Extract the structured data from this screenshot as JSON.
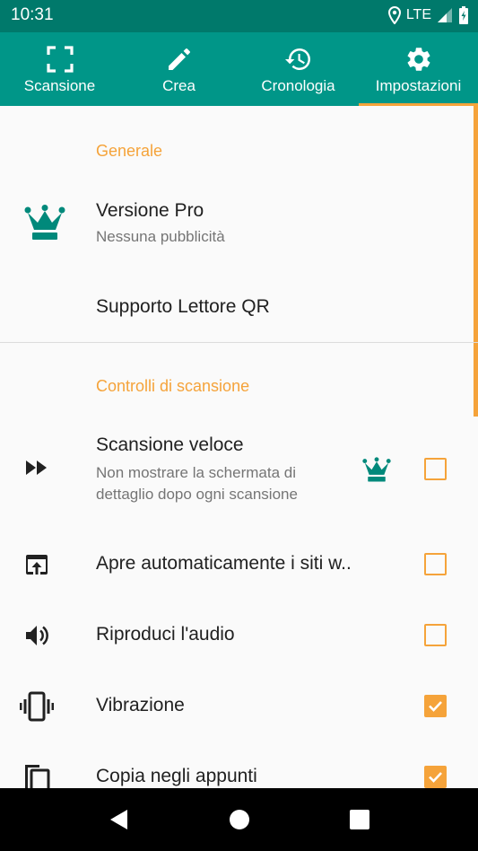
{
  "status_bar": {
    "time": "10:31",
    "network": "LTE",
    "icons": [
      "location-icon",
      "signal-icon",
      "battery-icon"
    ]
  },
  "tabs": [
    {
      "label": "Scansione",
      "icon": "scan-icon",
      "selected": false
    },
    {
      "label": "Crea",
      "icon": "pencil-icon",
      "selected": false
    },
    {
      "label": "Cronologia",
      "icon": "history-icon",
      "selected": false
    },
    {
      "label": "Impostazioni",
      "icon": "gear-icon",
      "selected": true
    }
  ],
  "sections": {
    "general": {
      "title": "Generale",
      "pro": {
        "title": "Versione Pro",
        "summary": "Nessuna pubblicità",
        "icon": "crown-icon"
      },
      "support": {
        "title": "Supporto Lettore QR"
      }
    },
    "scan": {
      "title": "Controlli di scansione",
      "fast_scan": {
        "title": "Scansione veloce",
        "summary": "Non mostrare la schermata di dettaglio dopo ogni scansione",
        "icon": "fast-forward-icon",
        "badge": "crown-icon",
        "checked": false
      },
      "open_sites": {
        "title": "Apre automaticamente i siti w..",
        "icon": "open-in-browser-icon",
        "checked": false
      },
      "audio": {
        "title": "Riproduci l'audio",
        "icon": "volume-icon",
        "checked": false
      },
      "vibration": {
        "title": "Vibrazione",
        "icon": "vibration-icon",
        "checked": true
      },
      "clipboard": {
        "title": "Copia negli appunti",
        "icon": "copy-icon",
        "checked": true
      }
    }
  },
  "colors": {
    "primary": "#009688",
    "primary_dark": "#00796b",
    "accent": "#f5a33a",
    "crown": "#00897b"
  },
  "nav_bar": {
    "buttons": [
      "back-icon",
      "home-icon",
      "recents-icon"
    ]
  }
}
